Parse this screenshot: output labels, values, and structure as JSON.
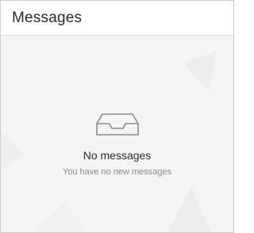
{
  "panel": {
    "title": "Messages"
  },
  "empty_state": {
    "icon": "inbox-icon",
    "title": "No messages",
    "subtitle": "You have no new messages"
  },
  "colors": {
    "header_bg": "#ffffff",
    "body_bg": "#f4f4f5",
    "title_text": "#2b2b2b",
    "subtitle_text": "#8a8a8a",
    "icon_stroke": "#8c8c8c"
  }
}
